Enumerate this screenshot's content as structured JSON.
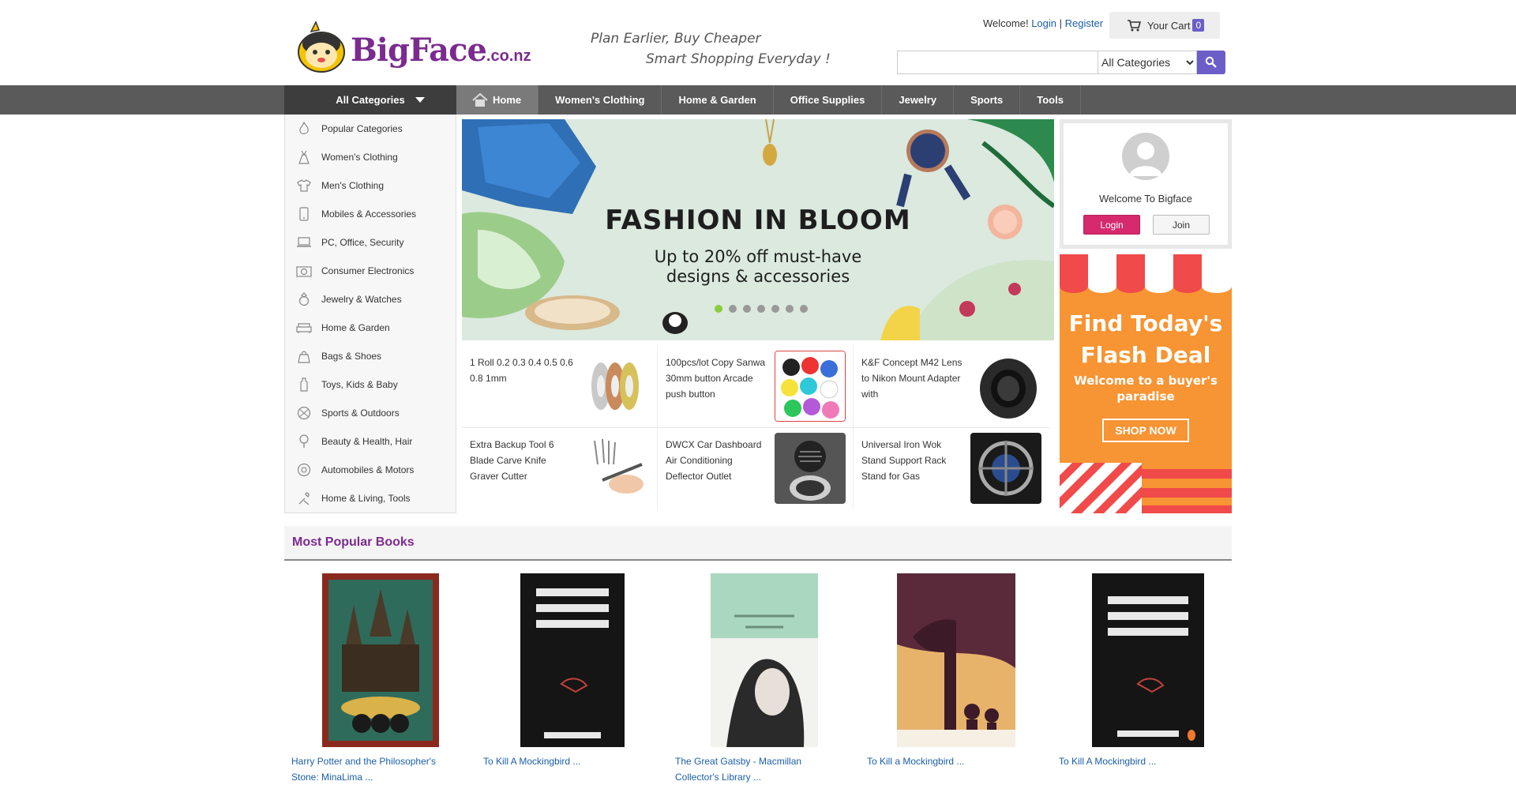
{
  "header": {
    "logo_brand": "BigFace",
    "logo_suffix": ".co.nz",
    "slogan_line1": "Plan Earlier, Buy Cheaper",
    "slogan_line2": "Smart Shopping Everyday !",
    "welcome_text": "Welcome!",
    "login_link": "Login",
    "separator": "|",
    "register_link": "Register",
    "cart_label": "Your Cart",
    "cart_count": "0",
    "search_placeholder": "",
    "search_category": "All Categories"
  },
  "nav": {
    "all_categories": "All Categories",
    "items": [
      "Home",
      "Women's Clothing",
      "Home & Garden",
      "Office Supplies",
      "Jewelry",
      "Sports",
      "Tools"
    ]
  },
  "sidebar": {
    "items": [
      {
        "label": "Popular Categories",
        "icon": "flame-icon"
      },
      {
        "label": "Women's Clothing",
        "icon": "dress-icon"
      },
      {
        "label": "Men's Clothing",
        "icon": "shirt-icon"
      },
      {
        "label": "Mobiles & Accessories",
        "icon": "phone-icon"
      },
      {
        "label": "PC, Office, Security",
        "icon": "laptop-icon"
      },
      {
        "label": "Consumer Electronics",
        "icon": "camera-icon"
      },
      {
        "label": "Jewelry & Watches",
        "icon": "ring-icon"
      },
      {
        "label": "Home & Garden",
        "icon": "sofa-icon"
      },
      {
        "label": "Bags & Shoes",
        "icon": "bag-icon"
      },
      {
        "label": "Toys, Kids & Baby",
        "icon": "bottle-icon"
      },
      {
        "label": "Sports & Outdoors",
        "icon": "ball-icon"
      },
      {
        "label": "Beauty & Health, Hair",
        "icon": "mirror-icon"
      },
      {
        "label": "Automobiles & Motors",
        "icon": "wheel-icon"
      },
      {
        "label": "Home & Living, Tools",
        "icon": "tools-icon"
      }
    ]
  },
  "banner": {
    "headline": "FASHION IN BLOOM",
    "sub1": "Up to 20% off must-have",
    "sub2": "designs & accessories",
    "active_dot": 0,
    "dot_count": 7
  },
  "products": [
    {
      "title": "1 Roll 0.2 0.3 0.4 0.5 0.6 0.8 1mm"
    },
    {
      "title": "100pcs/lot Copy Sanwa 30mm button Arcade push button"
    },
    {
      "title": "K&F Concept M42 Lens to Nikon Mount Adapter with"
    },
    {
      "title": "Extra Backup Tool 6 Blade Carve Knife Graver Cutter"
    },
    {
      "title": "DWCX Car Dashboard Air Conditioning Deflector Outlet"
    },
    {
      "title": "Universal Iron Wok Stand Support Rack Stand for Gas"
    }
  ],
  "welcome_box": {
    "text": "Welcome To Bigface",
    "login": "Login",
    "join": "Join"
  },
  "flash": {
    "line1": "Find Today's",
    "line2": "Flash Deal",
    "sub1": "Welcome to a buyer's",
    "sub2": "paradise",
    "button": "SHOP NOW"
  },
  "books": {
    "heading": "Most Popular Books",
    "items": [
      {
        "title": "Harry Potter and the Philosopher's Stone: MinaLima ..."
      },
      {
        "title": "To Kill A Mockingbird ..."
      },
      {
        "title": "The Great Gatsby - Macmillan Collector's Library ..."
      },
      {
        "title": "To Kill a Mockingbird ..."
      },
      {
        "title": "To Kill A Mockingbird ..."
      }
    ]
  }
}
